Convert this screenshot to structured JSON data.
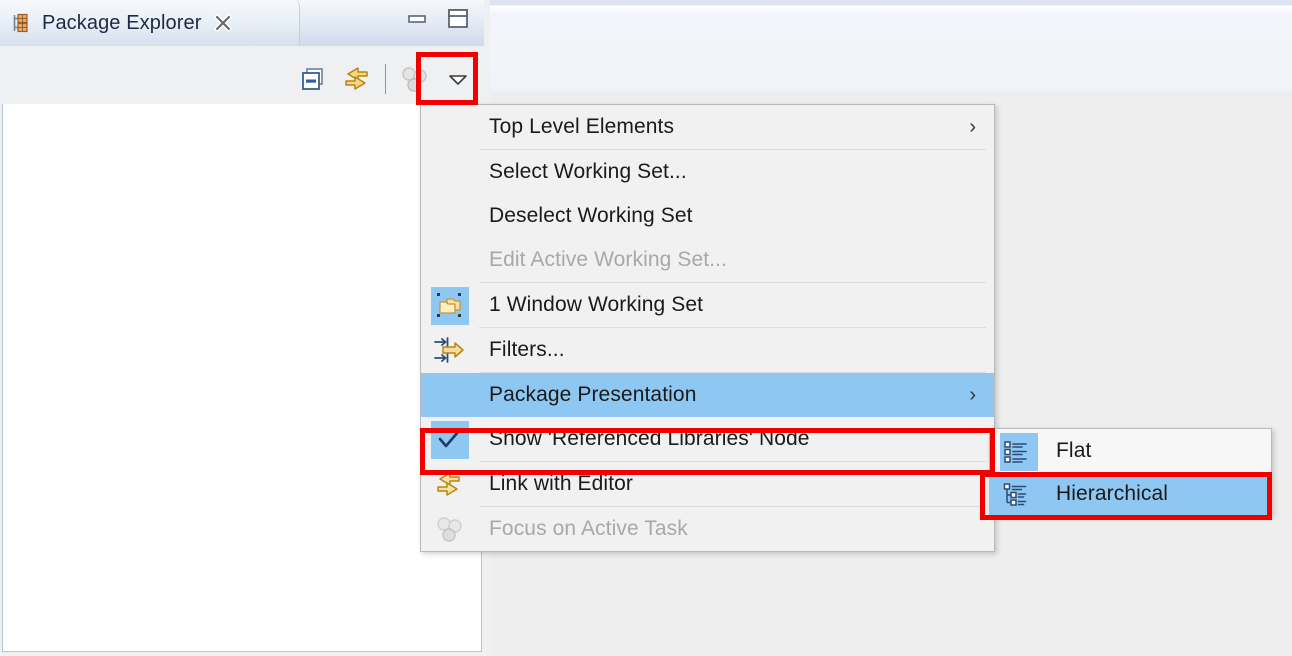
{
  "view": {
    "title": "Package Explorer",
    "tab_icon": "package-explorer-icon",
    "close_icon": "close-x-icon",
    "minimize_icon": "minimize-icon",
    "maximize_icon": "maximize-icon",
    "toolbar": [
      {
        "name": "collapse-all-icon",
        "label": "Collapse All"
      },
      {
        "name": "link-with-editor-icon",
        "label": "Link with Editor"
      },
      {
        "name": "focus-on-active-task-icon",
        "label": "Focus on Active Task"
      },
      {
        "name": "view-menu-chevron-icon",
        "label": "View Menu"
      }
    ]
  },
  "menu": {
    "items": [
      {
        "label": "Top Level Elements",
        "icon": "",
        "submenu": true,
        "disabled": false,
        "checked": false,
        "highlighted": false,
        "arrow": "›"
      },
      {
        "label": "Select Working Set...",
        "icon": "",
        "submenu": false,
        "disabled": false,
        "checked": false,
        "highlighted": false
      },
      {
        "label": "Deselect Working Set",
        "icon": "",
        "submenu": false,
        "disabled": false,
        "checked": false,
        "highlighted": false
      },
      {
        "label": "Edit Active Working Set...",
        "icon": "",
        "submenu": false,
        "disabled": true,
        "checked": false,
        "highlighted": false
      },
      {
        "label": "1 Window Working Set",
        "icon": "working-set-icon",
        "submenu": false,
        "disabled": false,
        "checked": true,
        "highlighted": false
      },
      {
        "label": "Filters...",
        "icon": "filters-icon",
        "submenu": false,
        "disabled": false,
        "checked": false,
        "highlighted": false
      },
      {
        "label": "Package Presentation",
        "icon": "",
        "submenu": true,
        "disabled": false,
        "checked": false,
        "highlighted": true,
        "arrow": "›"
      },
      {
        "label": "Show 'Referenced Libraries' Node",
        "icon": "checkmark-icon",
        "submenu": false,
        "disabled": false,
        "checked": true,
        "highlighted": false
      },
      {
        "label": "Link with Editor",
        "icon": "link-with-editor-icon",
        "submenu": false,
        "disabled": false,
        "checked": false,
        "highlighted": false
      },
      {
        "label": "Focus on Active Task",
        "icon": "focus-on-active-task-icon",
        "submenu": false,
        "disabled": true,
        "checked": false,
        "highlighted": false
      }
    ]
  },
  "submenu": {
    "title": "Package Presentation",
    "items": [
      {
        "label": "Flat",
        "icon": "flat-list-icon",
        "checked": true,
        "highlighted": false
      },
      {
        "label": "Hierarchical",
        "icon": "hierarchical-tree-icon",
        "checked": true,
        "highlighted": true
      }
    ]
  },
  "annotations": {
    "accent_color": "#f10000",
    "boxes": [
      {
        "name": "view-menu-button-annotation",
        "target": "view-menu-chevron-icon"
      },
      {
        "name": "package-presentation-annotation",
        "target": "Package Presentation"
      },
      {
        "name": "hierarchical-annotation",
        "target": "Hierarchical"
      }
    ]
  },
  "colors": {
    "highlight": "#8ec7f2",
    "menu_bg": "#f1f1f1",
    "submenu_bg": "#f7f7f7",
    "disabled_text": "#a8a8a8",
    "text": "#1a1a1a",
    "tab_text": "#1b2a44"
  }
}
